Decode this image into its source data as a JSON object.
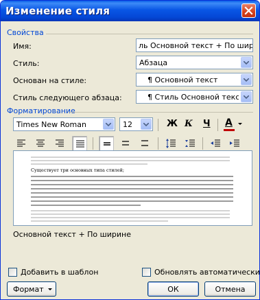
{
  "window": {
    "title": "Изменение стиля"
  },
  "properties": {
    "section_label": "Свойства",
    "name_label": "Имя:",
    "name_value": "ль Основной текст + По ширине",
    "style_type_label": "Стиль:",
    "style_type_value": "Абзаца",
    "based_on_label": "Основан на стиле:",
    "based_on_value": "¶ Основной текст",
    "next_style_label": "Стиль следующего абзаца:",
    "next_style_value": "¶ Стиль Основной текст +"
  },
  "formatting": {
    "section_label": "Форматирование",
    "font_value": "Times New Roman",
    "size_value": "12",
    "bold_label": "Ж",
    "italic_label": "К",
    "underline_label": "Ч",
    "font_color_label": "A",
    "font_color": "#c00000"
  },
  "preview": {
    "sample_text": "Существует три основных типа стилей;"
  },
  "description": "Основной текст + По ширине",
  "options": {
    "add_to_template_label": "Добавить в шаблон",
    "auto_update_label": "Обновлять автоматически"
  },
  "buttons": {
    "format_label": "Формат",
    "ok_label": "ОК",
    "cancel_label": "Отмена"
  },
  "colors": {
    "title_bar": "#0a5ee8",
    "section_text": "#0046d5",
    "dialog_bg": "#ece9d8"
  }
}
